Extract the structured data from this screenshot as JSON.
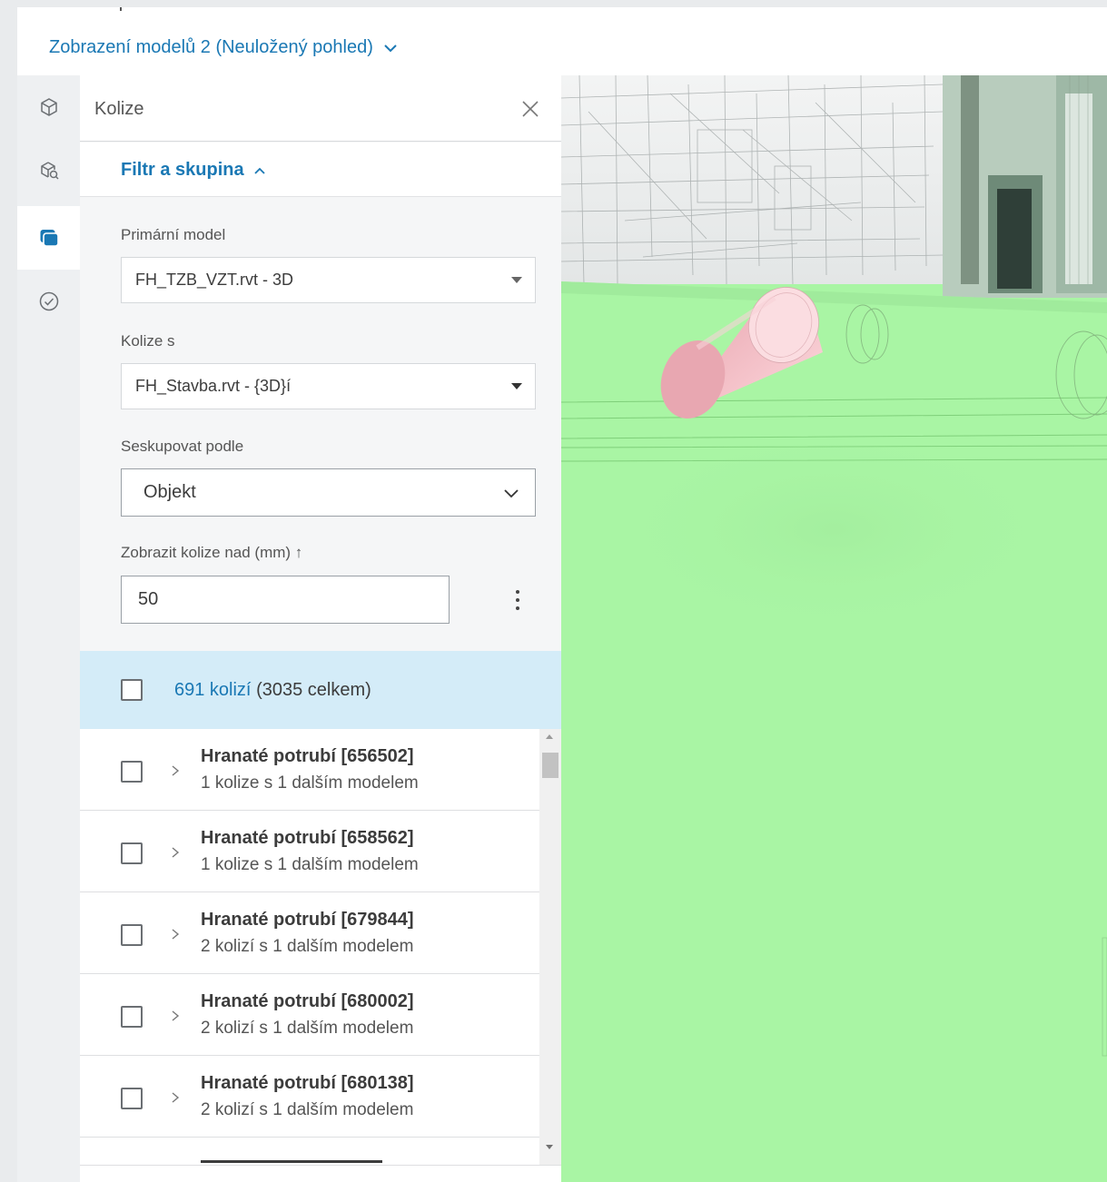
{
  "header": {
    "view_title": "Zobrazení modelů 2 (Neuložený pohled)"
  },
  "sidebar_icons": [
    "cube-icon",
    "model-search-icon",
    "clash-icon",
    "checkmark-circle-icon"
  ],
  "panel": {
    "title": "Kolize",
    "section_title": "Filtr a skupina",
    "primary_model": {
      "label": "Primární model",
      "value": "FH_TZB_VZT.rvt - 3D"
    },
    "clash_with": {
      "label": "Kolize s",
      "value": "FH_Stavba.rvt - {3D}í"
    },
    "group_by": {
      "label": "Seskupovat podle",
      "value": "Objekt"
    },
    "threshold": {
      "label": "Zobrazit kolize nad (mm) ↑",
      "value": "50"
    },
    "summary": {
      "count_link": "691 kolizí",
      "total": "(3035 celkem)"
    },
    "rows": [
      {
        "title": "Hranaté potrubí [656502]",
        "subtitle": "1 kolize s 1 dalším modelem"
      },
      {
        "title": "Hranaté potrubí [658562]",
        "subtitle": "1 kolize s 1 dalším modelem"
      },
      {
        "title": "Hranaté potrubí [679844]",
        "subtitle": "2 kolizí s 1 dalším modelem"
      },
      {
        "title": "Hranaté potrubí [680002]",
        "subtitle": "2 kolizí s 1 dalším modelem"
      },
      {
        "title": "Hranaté potrubí [680138]",
        "subtitle": "2 kolizí s 1 dalším modelem"
      }
    ]
  },
  "colors": {
    "accent": "#1a78b4",
    "selection_bg": "#d4ecf8",
    "model_green": "#a9f5a4",
    "clash_pink": "#f2b7bf"
  }
}
